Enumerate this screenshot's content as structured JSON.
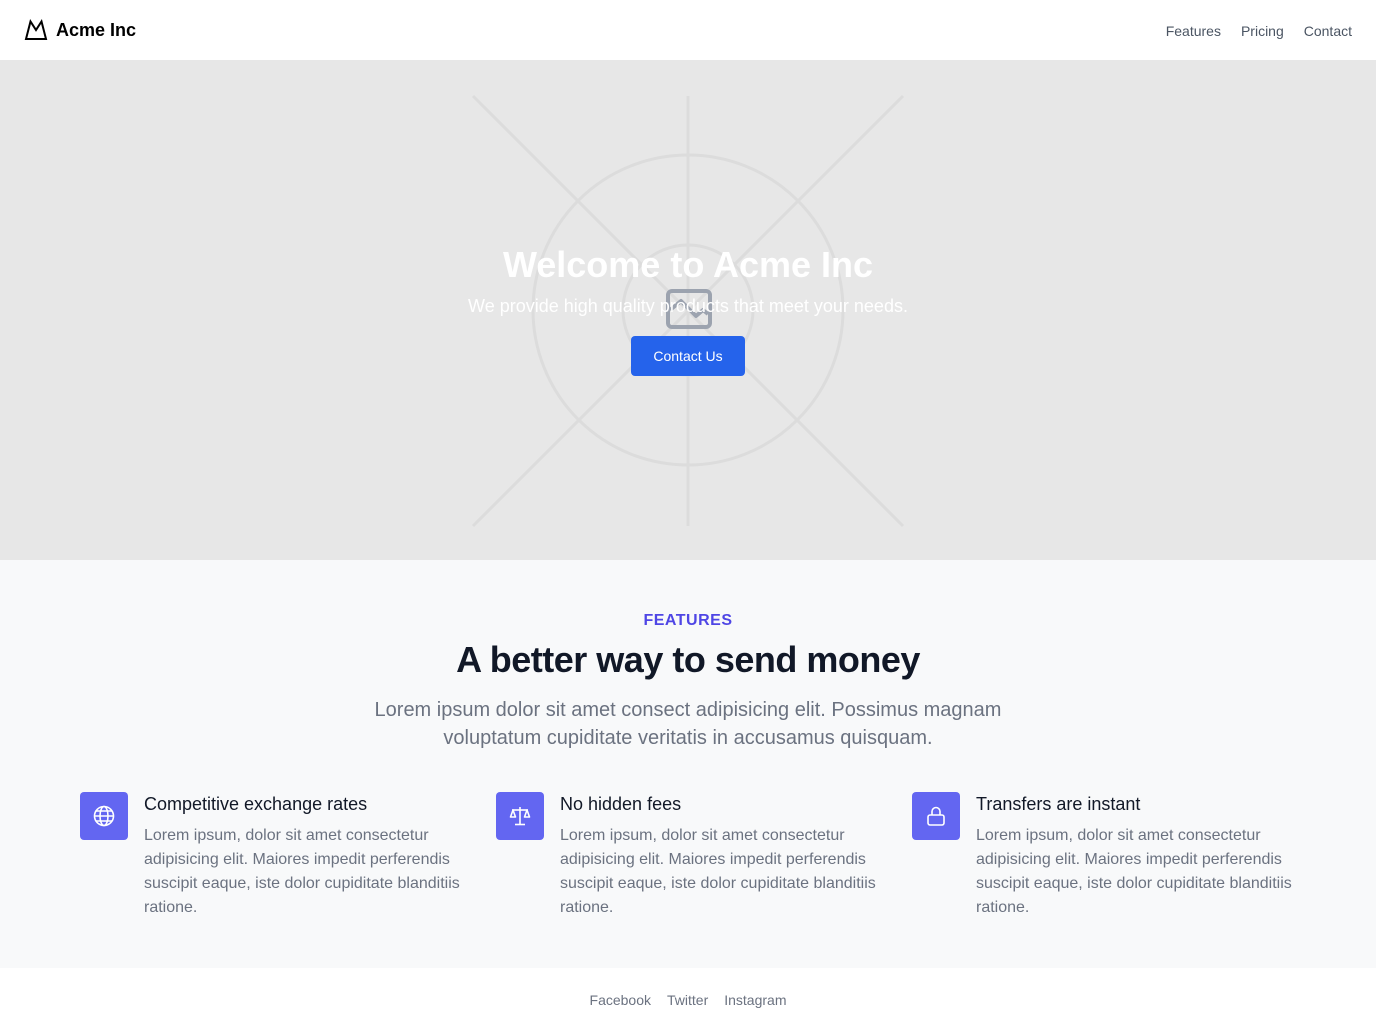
{
  "header": {
    "brand_name": "Acme Inc",
    "logo_icon": "mountain-icon",
    "nav": [
      {
        "label": "Features"
      },
      {
        "label": "Pricing"
      },
      {
        "label": "Contact"
      }
    ]
  },
  "hero": {
    "title": "Welcome to Acme Inc",
    "subtitle": "We provide high quality products that meet your needs.",
    "cta_label": "Contact Us",
    "image_icon": "image-placeholder-icon"
  },
  "features": {
    "eyebrow": "FEATURES",
    "heading": "A better way to send money",
    "lead": "Lorem ipsum dolor sit amet consect adipisicing elit. Possimus magnam voluptatum cupiditate veritatis in accusamus quisquam.",
    "items": [
      {
        "icon": "globe-icon",
        "title": "Competitive exchange rates",
        "description": "Lorem ipsum, dolor sit amet consectetur adipisicing elit. Maiores impedit perferendis suscipit eaque, iste dolor cupiditate blanditiis ratione."
      },
      {
        "icon": "scale-icon",
        "title": "No hidden fees",
        "description": "Lorem ipsum, dolor sit amet consectetur adipisicing elit. Maiores impedit perferendis suscipit eaque, iste dolor cupiditate blanditiis ratione."
      },
      {
        "icon": "lock-icon",
        "title": "Transfers are instant",
        "description": "Lorem ipsum, dolor sit amet consectetur adipisicing elit. Maiores impedit perferendis suscipit eaque, iste dolor cupiditate blanditiis ratione."
      }
    ]
  },
  "footer": {
    "links": [
      {
        "label": "Facebook"
      },
      {
        "label": "Twitter"
      },
      {
        "label": "Instagram"
      }
    ]
  },
  "colors": {
    "accent": "#2563eb",
    "feature_icon_bg": "#6366f1",
    "eyebrow": "#4f46e5",
    "hero_bg": "#e7e7e7",
    "features_bg": "#f8f9fa"
  }
}
